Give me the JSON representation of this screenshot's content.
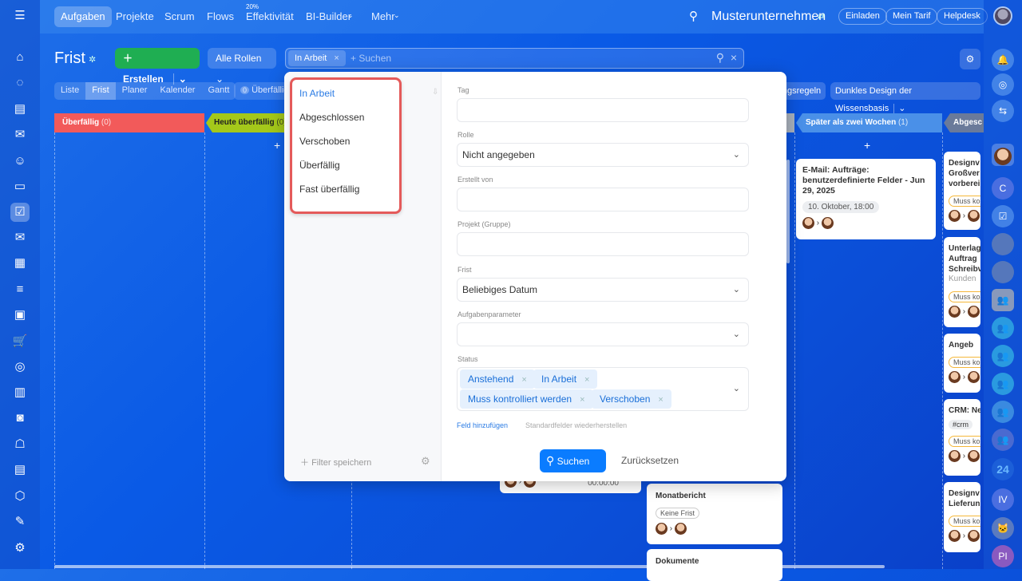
{
  "topnav": {
    "items": [
      "Aufgaben",
      "Projekte",
      "Scrum",
      "Flows",
      "Effektivität",
      "BI-Builder",
      "Mehr"
    ],
    "efficiency_badge": "20%",
    "company": "Musterunternehmen",
    "invite": "Einladen",
    "plan": "Mein Tarif",
    "helpdesk": "Helpdesk"
  },
  "toolbar": {
    "title": "Frist",
    "create": "Erstellen",
    "roles": "Alle Rollen",
    "filter_chip": "In Arbeit",
    "search_placeholder": "+ Suchen"
  },
  "views": [
    "Liste",
    "Frist",
    "Planer",
    "Kalender",
    "Gantt"
  ],
  "counter": {
    "count": "0",
    "label": "Überfällig"
  },
  "rules_btn": "sierungsregeln",
  "kb_btn": "Dunkles Design der Wissensbasis",
  "columns": [
    {
      "title": "Überfällig",
      "count": "(0)",
      "color": "#f25a5a"
    },
    {
      "title": "Heute überfällig",
      "count": "(0)",
      "color": "#a4c81a"
    },
    {
      "title": "Später als zwei Wochen",
      "count": "(1)",
      "color": "#4a90e8"
    },
    {
      "title": "Abgesc",
      "count": "",
      "color": "#6a7a9a"
    }
  ],
  "cards": {
    "email": {
      "title": "E-Mail: Aufträge: benutzerdefinierte Felder - Jun 29, 2025",
      "date": "10. Oktober, 18:00"
    },
    "monat": {
      "title": "Monatbericht",
      "tag": "Keine Frist"
    },
    "doku": {
      "title": "Dokumente"
    },
    "timer": "00:00:00",
    "right": [
      {
        "title": "Designv Großver vorberei",
        "tag": "Muss ko"
      },
      {
        "title": "Unterlag Auftrag Schreibv",
        "sub": "Kunden",
        "tag": "Muss ko"
      },
      {
        "title": "Angeb",
        "tag": "Muss ko"
      },
      {
        "title": "CRM: Ne",
        "hash": "#crm",
        "tag": "Muss ko"
      },
      {
        "title": "Designv Lieferun",
        "tag": "Muss ko"
      }
    ]
  },
  "popup": {
    "presets": [
      "In Arbeit",
      "Abgeschlossen",
      "Verschoben",
      "Überfällig",
      "Fast überfällig"
    ],
    "save_filter": "Filter speichern",
    "fields": [
      {
        "label": "Tag",
        "value": ""
      },
      {
        "label": "Rolle",
        "value": "Nicht angegeben"
      },
      {
        "label": "Erstellt von",
        "value": ""
      },
      {
        "label": "Projekt (Gruppe)",
        "value": ""
      },
      {
        "label": "Frist",
        "value": "Beliebiges Datum"
      },
      {
        "label": "Aufgabenparameter",
        "value": ""
      }
    ],
    "status_label": "Status",
    "status_chips": [
      "Anstehend",
      "In Arbeit",
      "Muss kontrolliert werden",
      "Verschoben"
    ],
    "add_field": "Feld hinzufügen",
    "restore": "Standardfelder wiederherstellen",
    "search": "Suchen",
    "reset": "Zurücksetzen"
  },
  "rightbar": {
    "c": "C",
    "n24": "24",
    "iv": "IV",
    "pi": "PI"
  }
}
